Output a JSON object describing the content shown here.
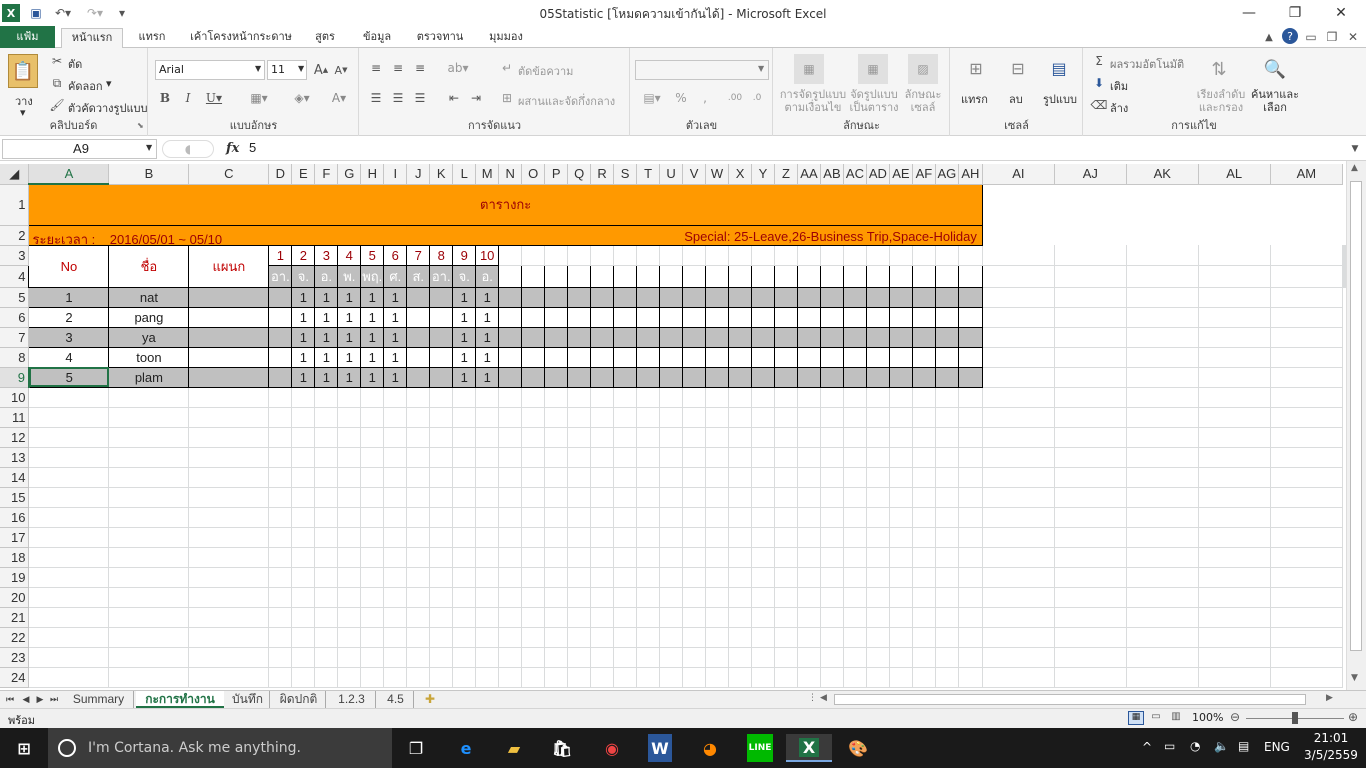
{
  "window": {
    "title": "05Statistic  [โหมดความเข้ากันได้] - Microsoft Excel",
    "min": "—",
    "restore": "❐",
    "close": "✕"
  },
  "tabs": [
    "แฟ้ม",
    "หน้าแรก",
    "แทรก",
    "เค้าโครงหน้ากระดาษ",
    "สูตร",
    "ข้อมูล",
    "ตรวจทาน",
    "มุมมอง"
  ],
  "ribbon": {
    "clipboard": {
      "paste": "วาง",
      "cut": "ตัด",
      "copy": "คัดลอก",
      "format_painter": "ตัวคัดวางรูปแบบ",
      "label": "คลิปบอร์ด"
    },
    "font": {
      "name": "Arial",
      "size": "11",
      "label": "แบบอักษร"
    },
    "alignment": {
      "wrap": "ตัดข้อความ",
      "merge": "ผสานและจัดกึ่งกลาง",
      "label": "การจัดแนว"
    },
    "number": {
      "label": "ตัวเลข"
    },
    "styles": {
      "conditional": "การจัดรูปแบบ ตามเงื่อนไข",
      "format_table": "จัดรูปแบบ เป็นตาราง",
      "cell_styles": "ลักษณะ เซลล์",
      "label": "ลักษณะ"
    },
    "cells": {
      "insert": "แทรก",
      "delete": "ลบ",
      "format": "รูปแบบ",
      "label": "เซลล์"
    },
    "editing": {
      "autosum": "ผลรวมอัตโนมัติ",
      "fill": "เติม",
      "clear": "ล้าง",
      "sort": "เรียงลำดับ และกรอง",
      "find": "ค้นหาและ เลือก",
      "label": "การแก้ไข"
    }
  },
  "formula_bar": {
    "name_box": "A9",
    "fx": "fx",
    "value": "5"
  },
  "columns": [
    "A",
    "B",
    "C",
    "D",
    "E",
    "F",
    "G",
    "H",
    "I",
    "J",
    "K",
    "L",
    "M",
    "N",
    "O",
    "P",
    "Q",
    "R",
    "S",
    "T",
    "U",
    "V",
    "W",
    "X",
    "Y",
    "Z",
    "AA",
    "AB",
    "AC",
    "AD",
    "AE",
    "AF",
    "AG",
    "AH",
    "AI",
    "AJ",
    "AK",
    "AL",
    "AM"
  ],
  "sheet": {
    "banner": "ตารางกะ",
    "period_label": "ระยะเวลา :    2016/05/01 ~ 05/10",
    "special": "Special: 25-Leave,26-Business Trip,Space-Holiday",
    "headers": {
      "no": "No",
      "name": "ชื่อ",
      "dept": "แผนก"
    },
    "days": [
      "1",
      "2",
      "3",
      "4",
      "5",
      "6",
      "7",
      "8",
      "9",
      "10"
    ],
    "weekdays": [
      "อา.",
      "จ.",
      "อ.",
      "พ.",
      "พฤ.",
      "ศ.",
      "ส.",
      "อา.",
      "จ.",
      "อ."
    ],
    "rows": [
      {
        "no": "1",
        "name": "nat",
        "vals": [
          "",
          "1",
          "1",
          "1",
          "1",
          "1",
          "",
          "",
          "1",
          "1"
        ]
      },
      {
        "no": "2",
        "name": "pang",
        "vals": [
          "",
          "1",
          "1",
          "1",
          "1",
          "1",
          "",
          "",
          "1",
          "1"
        ]
      },
      {
        "no": "3",
        "name": "ya",
        "vals": [
          "",
          "1",
          "1",
          "1",
          "1",
          "1",
          "",
          "",
          "1",
          "1"
        ]
      },
      {
        "no": "4",
        "name": "toon",
        "vals": [
          "",
          "1",
          "1",
          "1",
          "1",
          "1",
          "",
          "",
          "1",
          "1"
        ]
      },
      {
        "no": "5",
        "name": "plam",
        "vals": [
          "",
          "1",
          "1",
          "1",
          "1",
          "1",
          "",
          "",
          "1",
          "1"
        ]
      }
    ]
  },
  "sheet_tabs": [
    "Summary",
    "กะการทำงาน",
    "บันทึก",
    "ผิดปกติ",
    "1.2.3",
    "4.5"
  ],
  "status": {
    "ready": "พร้อม",
    "zoom": "100%"
  },
  "taskbar": {
    "cortana": "I'm Cortana. Ask me anything.",
    "lang": "ENG",
    "time": "21:01",
    "date": "3/5/2559"
  }
}
